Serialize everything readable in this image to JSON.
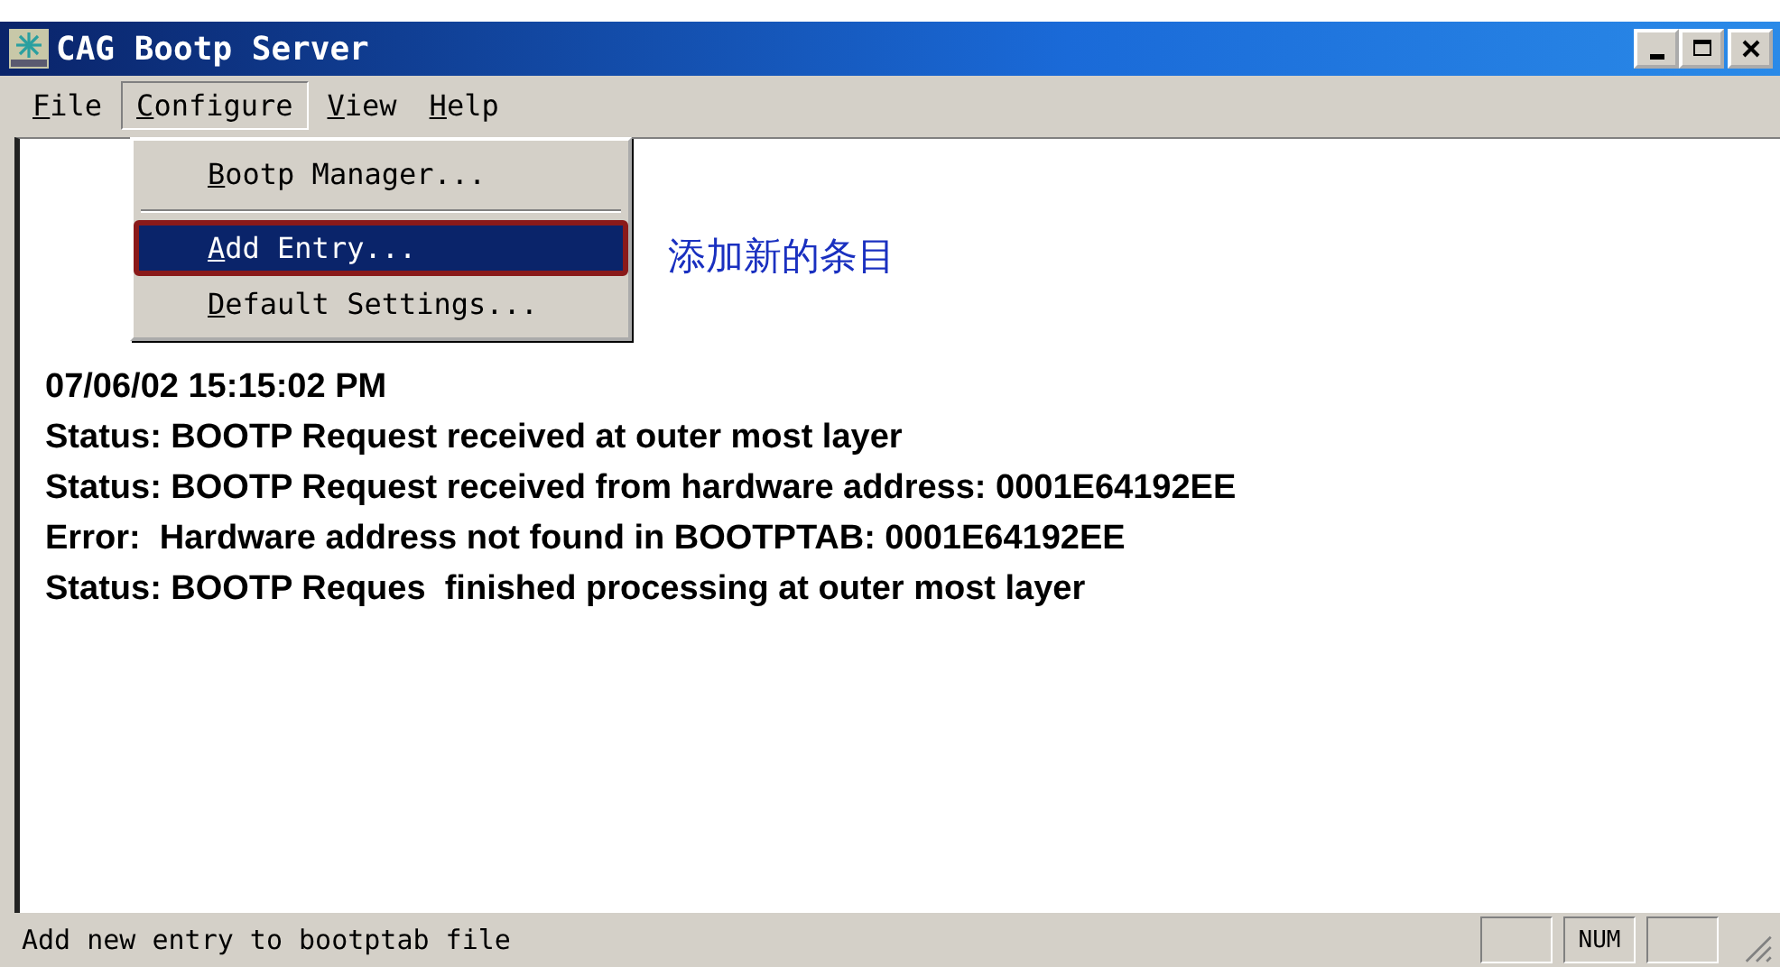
{
  "window": {
    "title": "CAG Bootp Server",
    "controls": [
      {
        "kind": "minimize"
      },
      {
        "kind": "maximize"
      },
      {
        "kind": "close"
      }
    ]
  },
  "menu_bar": [
    {
      "label": "File",
      "selected": false
    },
    {
      "label": "Configure",
      "selected": true
    },
    {
      "label": "View",
      "selected": false
    },
    {
      "label": "Help",
      "selected": false
    }
  ],
  "dropdown": {
    "items": [
      {
        "kind": "item",
        "label": "Bootp Manager...",
        "selected": false
      },
      {
        "kind": "separator"
      },
      {
        "kind": "item",
        "label": "Add Entry...",
        "selected": true,
        "highlighted_box": true
      },
      {
        "kind": "item",
        "label": "Default Settings...",
        "selected": false
      }
    ]
  },
  "annotation": "添加新的条目",
  "log_lines": [
    "07/06/02 15:15:02 PM",
    "Status: BOOTP Request received at outer most layer",
    "Status: BOOTP Request received from hardware address: 0001E64192EE",
    "Error:  Hardware address not found in BOOTPTAB: 0001E64192EE",
    "Status: BOOTP Reques  finished processing at outer most layer"
  ],
  "status_bar": {
    "message": "Add new entry to bootptab file",
    "indicators": [
      {
        "kind": "empty"
      },
      {
        "kind": "text",
        "label": "NUM"
      },
      {
        "kind": "empty"
      }
    ]
  }
}
